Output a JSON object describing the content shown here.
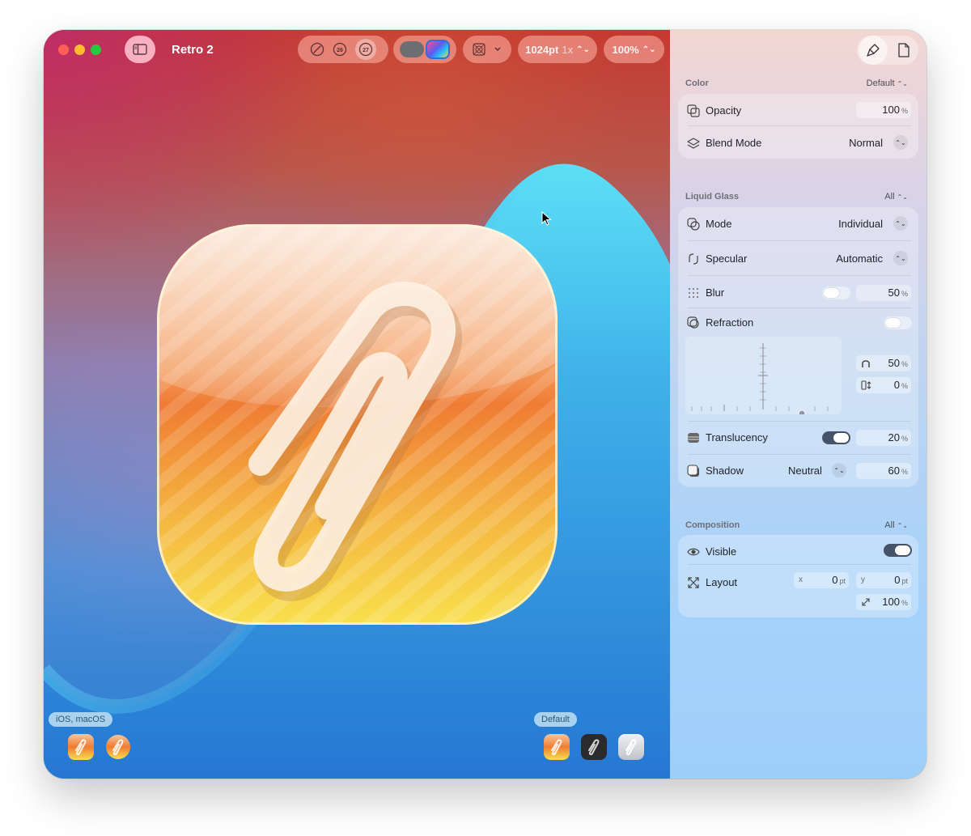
{
  "window": {
    "title": "Retro 2"
  },
  "toolbar": {
    "appearance_buttons": [
      {
        "icon": "none-slash-icon"
      },
      {
        "icon": "ios-26-icon",
        "label": "26"
      },
      {
        "icon": "ios-27-icon",
        "label": "27"
      }
    ],
    "canvas_size": "1024pt",
    "scale": "1x",
    "zoom": "100%"
  },
  "canvas": {
    "platform_group_left": {
      "label": "iOS, macOS"
    },
    "platform_group_right": {
      "label": "Default"
    }
  },
  "panel": {
    "color": {
      "title": "Color",
      "menu": "Default",
      "opacity": {
        "label": "Opacity",
        "value": "100",
        "unit": "%"
      },
      "blend_mode": {
        "label": "Blend Mode",
        "value": "Normal"
      }
    },
    "liquid_glass": {
      "title": "Liquid Glass",
      "menu": "All",
      "mode": {
        "label": "Mode",
        "value": "Individual"
      },
      "specular": {
        "label": "Specular",
        "value": "Automatic"
      },
      "blur": {
        "label": "Blur",
        "enabled": false,
        "value": "50",
        "unit": "%"
      },
      "refraction": {
        "label": "Refraction",
        "enabled": false,
        "amount": "50",
        "depth": "0",
        "unit": "%"
      },
      "translucency": {
        "label": "Translucency",
        "enabled": true,
        "value": "20",
        "unit": "%"
      },
      "shadow": {
        "label": "Shadow",
        "type": "Neutral",
        "value": "60",
        "unit": "%"
      }
    },
    "composition": {
      "title": "Composition",
      "menu": "All",
      "visible": {
        "label": "Visible",
        "enabled": true
      },
      "layout": {
        "label": "Layout",
        "x_label": "x",
        "x": "0",
        "y_label": "y",
        "y": "0",
        "unit": "pt",
        "scale": "100",
        "scale_unit": "%"
      }
    }
  },
  "colors": {
    "accent_toggle_on": "#45536a",
    "icon_orange": "#f07a32",
    "icon_yellow": "#f7d94a"
  }
}
